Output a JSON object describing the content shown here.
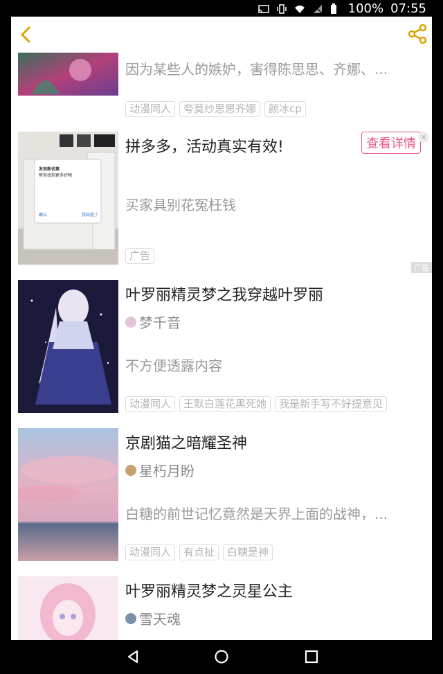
{
  "status_bar": {
    "battery": "100%",
    "time": "07:55"
  },
  "header": {
    "back_icon": "chevron-left-icon",
    "share_icon": "share-icon",
    "accent": "#d9a400"
  },
  "items": [
    {
      "desc": "因为某些人的嫉妒，害得陈思思、齐娜、...",
      "tags": [
        "动漫同人",
        "夸莫纱思思齐娜",
        "颜冰cp"
      ]
    },
    {
      "title": "拼多多，活动真实有效!",
      "desc": "买家具别花冤枉钱",
      "tags": [
        "广告"
      ],
      "ad_button": "查看详情",
      "ad_corner": "广告",
      "popup": {
        "title": "发现新优惠",
        "line1": "帮你找到更多好物",
        "confirm": "确认",
        "cancel": "我知道了"
      }
    },
    {
      "title": "叶罗丽精灵梦之我穿越叶罗丽",
      "author": "梦千音",
      "desc": "不方便透露内容",
      "tags": [
        "动漫同人",
        "王默白莲花黑死她",
        "我是新手写不好提意见"
      ]
    },
    {
      "title": "京剧猫之暗耀圣神",
      "author": "星朽月盼",
      "desc": "白糖的前世记忆竟然是天界上面的战神，...",
      "tags": [
        "动漫同人",
        "有点扯",
        "白糖是神"
      ]
    },
    {
      "title": "叶罗丽精灵梦之灵星公主",
      "author": "雪天魂"
    }
  ]
}
